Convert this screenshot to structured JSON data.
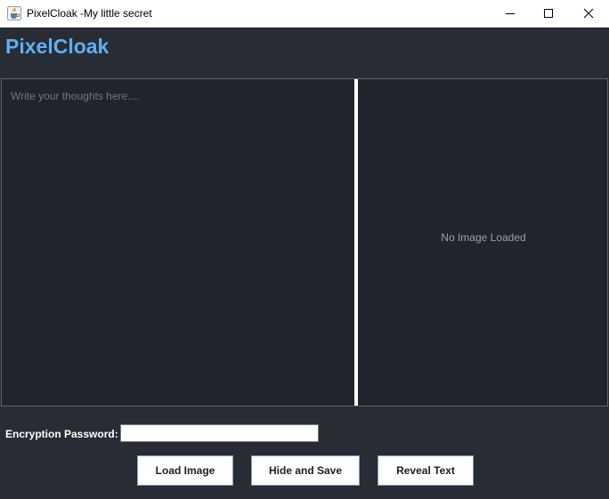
{
  "window": {
    "title": "PixelCloak -My little secret",
    "icons": {
      "app": "java-cup-icon",
      "minimize": "minimize-icon",
      "maximize": "maximize-icon",
      "close": "close-icon"
    }
  },
  "header": {
    "title": "PixelCloak",
    "accent_color": "#61afef"
  },
  "editor": {
    "placeholder": "Write your thoughts here....",
    "value": ""
  },
  "image_panel": {
    "status": "No Image Loaded"
  },
  "password": {
    "label": "Encryption Password:",
    "value": ""
  },
  "buttons": {
    "load": "Load Image",
    "hide_save": "Hide and Save",
    "reveal": "Reveal Text"
  },
  "colors": {
    "background": "#282c34",
    "panel": "#21252b",
    "border": "#5c6370"
  }
}
